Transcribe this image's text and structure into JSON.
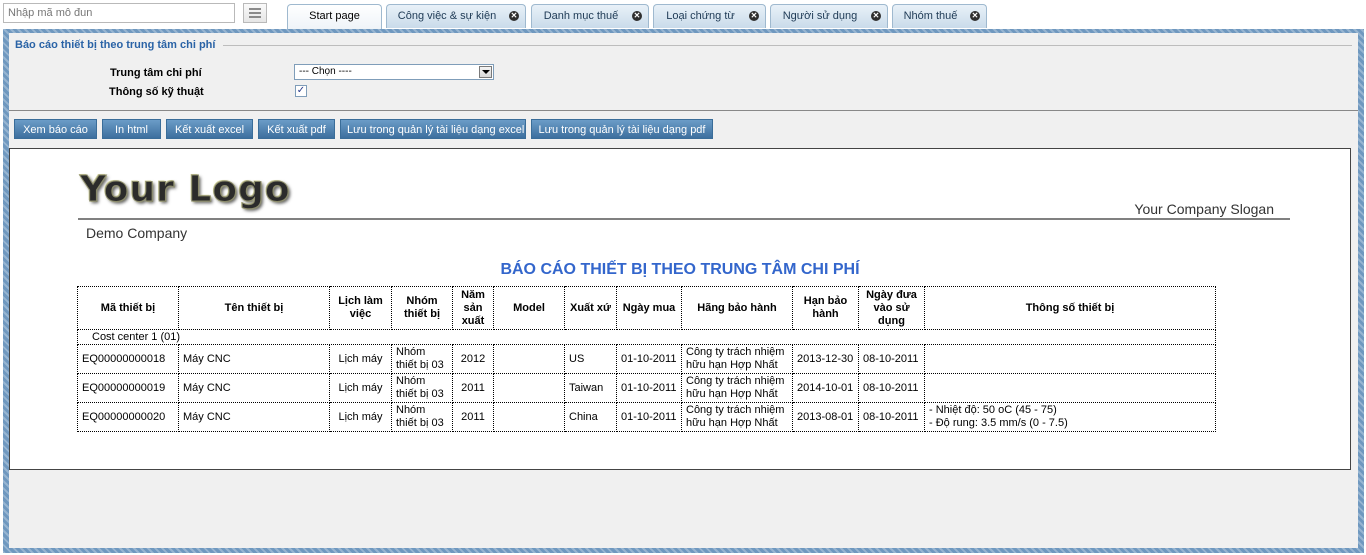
{
  "topbar": {
    "module_placeholder": "Nhập mã mô đun",
    "tabs": [
      {
        "label": "Start page",
        "closable": false,
        "active": true
      },
      {
        "label": "Công việc & sự kiện",
        "closable": true
      },
      {
        "label": "Danh mục thuế",
        "closable": true
      },
      {
        "label": "Loại chứng từ",
        "closable": true
      },
      {
        "label": "Người sử dụng",
        "closable": true
      },
      {
        "label": "Nhóm thuế",
        "closable": true
      }
    ],
    "close_glyph": "✕"
  },
  "form": {
    "section_title": "Báo cáo thiết bị theo trung tâm chi phí",
    "cost_center_label": "Trung tâm chi phí",
    "cost_center_value": "--- Chọn ----",
    "spec_label": "Thông số kỹ thuật",
    "spec_checked": true,
    "check_glyph": "✓"
  },
  "toolbar": {
    "view": "Xem báo cáo",
    "print": "In html",
    "excel": "Kết xuất excel",
    "pdf": "Kết xuất pdf",
    "save_excel": "Lưu trong quản lý tài liệu dạng excel",
    "save_pdf": "Lưu trong quản lý tài liệu dạng pdf"
  },
  "report": {
    "logo": "Your Logo",
    "slogan": "Your Company Slogan",
    "company": "Demo Company",
    "title": "BÁO CÁO THIẾT BỊ THEO TRUNG TÂM CHI PHÍ",
    "columns": [
      "Mã thiết bị",
      "Tên thiết bị",
      "Lịch làm việc",
      "Nhóm thiết bị",
      "Năm sản xuất",
      "Model",
      "Xuất xứ",
      "Ngày mua",
      "Hãng bảo hành",
      "Hạn bảo hành",
      "Ngày đưa vào sử dụng",
      "Thông số thiết bị"
    ],
    "group": "Cost center 1 (01)",
    "rows": [
      {
        "code": "EQ00000000018",
        "name": "Máy CNC",
        "schedule": "Lịch máy",
        "group": "Nhóm thiết bị 03",
        "year": "2012",
        "model": "",
        "origin": "US",
        "bought": "01-10-2011",
        "warranty_co": "Công ty trách nhiệm hữu hạn Hợp Nhất",
        "warranty_end": "2013-12-30",
        "in_use": "08-10-2011",
        "spec1": "",
        "spec2": ""
      },
      {
        "code": "EQ00000000019",
        "name": "Máy CNC",
        "schedule": "Lịch máy",
        "group": "Nhóm thiết bị 03",
        "year": "2011",
        "model": "",
        "origin": "Taiwan",
        "bought": "01-10-2011",
        "warranty_co": "Công ty trách nhiệm hữu hạn Hợp Nhất",
        "warranty_end": "2014-10-01",
        "in_use": "08-10-2011",
        "spec1": "",
        "spec2": ""
      },
      {
        "code": "EQ00000000020",
        "name": "Máy CNC",
        "schedule": "Lịch máy",
        "group": "Nhóm thiết bị 03",
        "year": "2011",
        "model": "",
        "origin": "China",
        "bought": "01-10-2011",
        "warranty_co": "Công ty trách nhiệm hữu hạn Hợp Nhất",
        "warranty_end": "2013-08-01",
        "in_use": "08-10-2011",
        "spec1": "- Nhiệt độ: 50 oC (45 - 75)",
        "spec2": "- Độ rung: 3.5 mm/s (0 - 7.5)"
      }
    ]
  }
}
